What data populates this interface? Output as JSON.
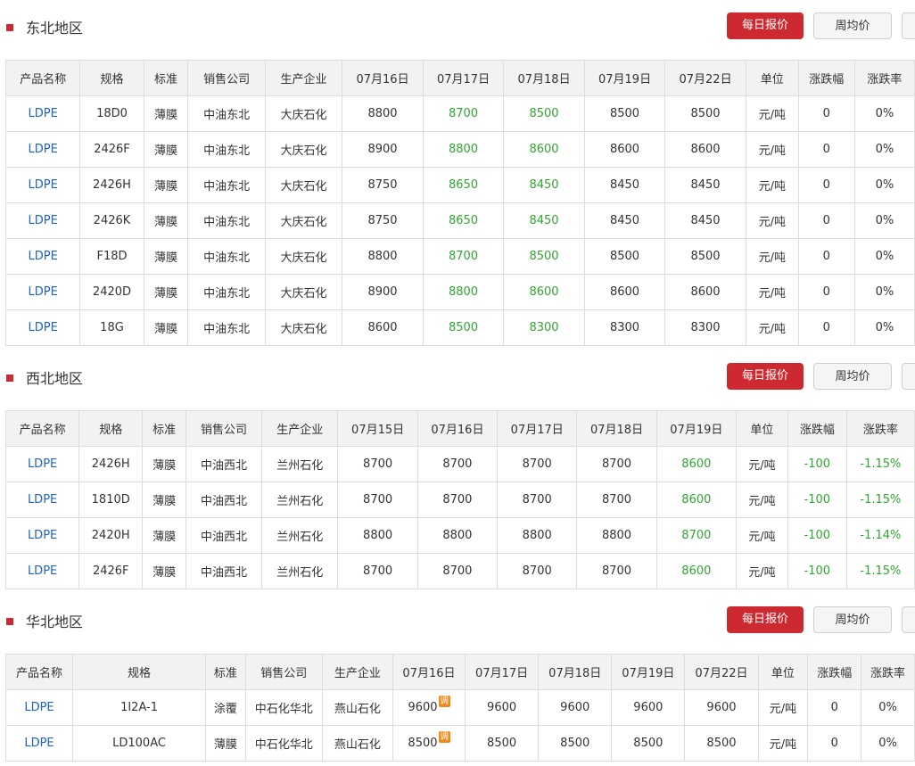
{
  "buttons": {
    "daily": "每日报价",
    "weekly": "周均价"
  },
  "sections": [
    {
      "title": "东北地区",
      "headers": [
        "产品名称",
        "规格",
        "标准",
        "销售公司",
        "生产企业",
        "07月16日",
        "07月17日",
        "07月18日",
        "07月19日",
        "07月22日",
        "单位",
        "涨跌幅",
        "涨跌率"
      ],
      "rows": [
        {
          "cells": [
            "LDPE",
            "18D0",
            "薄膜",
            "中油东北",
            "大庆石化",
            "8800",
            "8700",
            "8500",
            "8500",
            "8500",
            "元/吨",
            "0",
            "0%"
          ],
          "down": [
            6,
            7
          ]
        },
        {
          "cells": [
            "LDPE",
            "2426F",
            "薄膜",
            "中油东北",
            "大庆石化",
            "8900",
            "8800",
            "8600",
            "8600",
            "8600",
            "元/吨",
            "0",
            "0%"
          ],
          "down": [
            6,
            7
          ]
        },
        {
          "cells": [
            "LDPE",
            "2426H",
            "薄膜",
            "中油东北",
            "大庆石化",
            "8750",
            "8650",
            "8450",
            "8450",
            "8450",
            "元/吨",
            "0",
            "0%"
          ],
          "down": [
            6,
            7
          ]
        },
        {
          "cells": [
            "LDPE",
            "2426K",
            "薄膜",
            "中油东北",
            "大庆石化",
            "8750",
            "8650",
            "8450",
            "8450",
            "8450",
            "元/吨",
            "0",
            "0%"
          ],
          "down": [
            6,
            7
          ]
        },
        {
          "cells": [
            "LDPE",
            "F18D",
            "薄膜",
            "中油东北",
            "大庆石化",
            "8800",
            "8700",
            "8500",
            "8500",
            "8500",
            "元/吨",
            "0",
            "0%"
          ],
          "down": [
            6,
            7
          ]
        },
        {
          "cells": [
            "LDPE",
            "2420D",
            "薄膜",
            "中油东北",
            "大庆石化",
            "8900",
            "8800",
            "8600",
            "8600",
            "8600",
            "元/吨",
            "0",
            "0%"
          ],
          "down": [
            6,
            7
          ]
        },
        {
          "cells": [
            "LDPE",
            "18G",
            "薄膜",
            "中油东北",
            "大庆石化",
            "8600",
            "8500",
            "8300",
            "8300",
            "8300",
            "元/吨",
            "0",
            "0%"
          ],
          "down": [
            6,
            7
          ]
        }
      ]
    },
    {
      "title": "西北地区",
      "headers": [
        "产品名称",
        "规格",
        "标准",
        "销售公司",
        "生产企业",
        "07月15日",
        "07月16日",
        "07月17日",
        "07月18日",
        "07月19日",
        "单位",
        "涨跌幅",
        "涨跌率"
      ],
      "rows": [
        {
          "cells": [
            "LDPE",
            "2426H",
            "薄膜",
            "中油西北",
            "兰州石化",
            "8700",
            "8700",
            "8700",
            "8700",
            "8600",
            "元/吨",
            "-100",
            "-1.15%"
          ],
          "down": [
            9,
            11,
            12
          ]
        },
        {
          "cells": [
            "LDPE",
            "1810D",
            "薄膜",
            "中油西北",
            "兰州石化",
            "8700",
            "8700",
            "8700",
            "8700",
            "8600",
            "元/吨",
            "-100",
            "-1.15%"
          ],
          "down": [
            9,
            11,
            12
          ]
        },
        {
          "cells": [
            "LDPE",
            "2420H",
            "薄膜",
            "中油西北",
            "兰州石化",
            "8800",
            "8800",
            "8800",
            "8800",
            "8700",
            "元/吨",
            "-100",
            "-1.14%"
          ],
          "down": [
            9,
            11,
            12
          ]
        },
        {
          "cells": [
            "LDPE",
            "2426F",
            "薄膜",
            "中油西北",
            "兰州石化",
            "8700",
            "8700",
            "8700",
            "8700",
            "8600",
            "元/吨",
            "-100",
            "-1.15%"
          ],
          "down": [
            9,
            11,
            12
          ]
        }
      ]
    },
    {
      "title": "华北地区",
      "headers": [
        "产品名称",
        "规格",
        "标准",
        "销售公司",
        "生产企业",
        "07月16日",
        "07月17日",
        "07月18日",
        "07月19日",
        "07月22日",
        "单位",
        "涨跌幅",
        "涨跌率"
      ],
      "rows": [
        {
          "cells": [
            "LDPE",
            "1I2A-1",
            "涂覆",
            "中石化华北",
            "燕山石化",
            "9600",
            "9600",
            "9600",
            "9600",
            "9600",
            "元/吨",
            "0",
            "0%"
          ],
          "down": [],
          "tag_col": 5
        },
        {
          "cells": [
            "LDPE",
            "LD100AC",
            "薄膜",
            "中石化华北",
            "燕山石化",
            "8500",
            "8500",
            "8500",
            "8500",
            "8500",
            "元/吨",
            "0",
            "0%"
          ],
          "down": [],
          "tag_col": 5
        }
      ]
    }
  ],
  "adjust_tag": "调"
}
